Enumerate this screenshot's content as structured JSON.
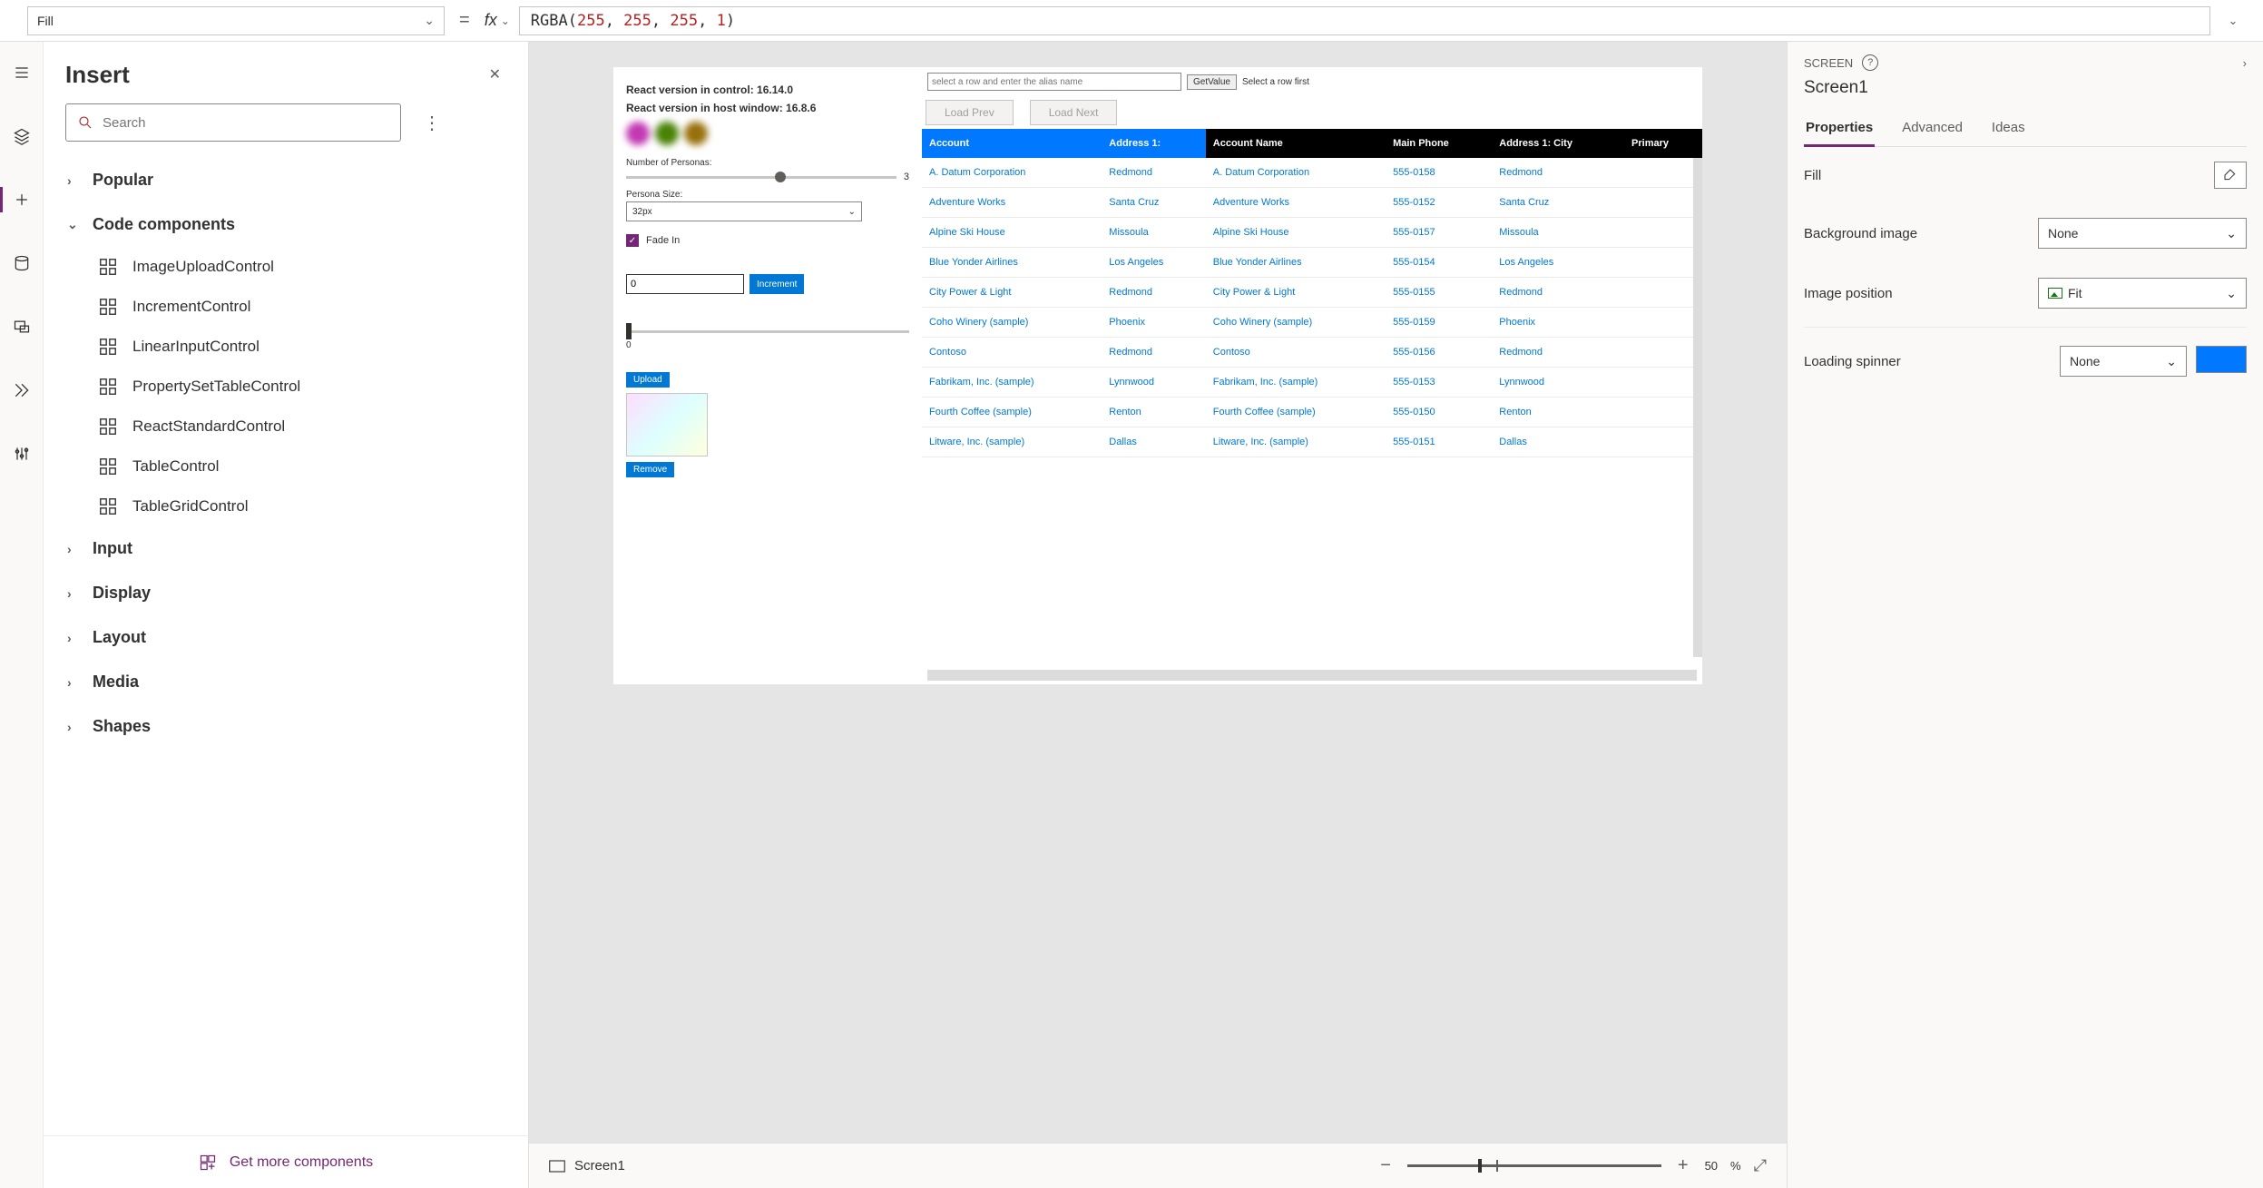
{
  "formula_bar": {
    "property": "Fill",
    "fx_label": "fx",
    "eq": "=",
    "formula_fn": "RGBA",
    "formula_args": [
      "255",
      "255",
      "255",
      "1"
    ]
  },
  "insert_panel": {
    "title": "Insert",
    "search_placeholder": "Search",
    "groups": {
      "popular": "Popular",
      "code_components": "Code components",
      "input": "Input",
      "display": "Display",
      "layout": "Layout",
      "media": "Media",
      "shapes": "Shapes"
    },
    "code_items": [
      "ImageUploadControl",
      "IncrementControl",
      "LinearInputControl",
      "PropertySetTableControl",
      "ReactStandardControl",
      "TableControl",
      "TableGridControl"
    ],
    "footer": "Get more components"
  },
  "canvas": {
    "left_pane": {
      "react_control": "React version in control: 16.14.0",
      "react_host": "React version in host window: 16.8.6",
      "num_personas_label": "Number of Personas:",
      "num_personas_value": "3",
      "persona_size_label": "Persona Size:",
      "persona_size_value": "32px",
      "fade_label": "Fade In",
      "increment_value": "0",
      "increment_btn": "Increment",
      "slider2_value": "0",
      "upload_btn": "Upload",
      "remove_btn": "Remove"
    },
    "right_pane": {
      "alias_placeholder": "select a row and enter the alias name",
      "get_value": "GetValue",
      "hint": "Select a row first",
      "load_prev": "Load Prev",
      "load_next": "Load Next",
      "headers": [
        "Account",
        "Address 1:",
        "Account Name",
        "Main Phone",
        "Address 1: City",
        "Primary"
      ],
      "rows": [
        [
          "A. Datum Corporation",
          "Redmond",
          "A. Datum Corporation",
          "555-0158",
          "Redmond"
        ],
        [
          "Adventure Works",
          "Santa Cruz",
          "Adventure Works",
          "555-0152",
          "Santa Cruz"
        ],
        [
          "Alpine Ski House",
          "Missoula",
          "Alpine Ski House",
          "555-0157",
          "Missoula"
        ],
        [
          "Blue Yonder Airlines",
          "Los Angeles",
          "Blue Yonder Airlines",
          "555-0154",
          "Los Angeles"
        ],
        [
          "City Power & Light",
          "Redmond",
          "City Power & Light",
          "555-0155",
          "Redmond"
        ],
        [
          "Coho Winery (sample)",
          "Phoenix",
          "Coho Winery (sample)",
          "555-0159",
          "Phoenix"
        ],
        [
          "Contoso",
          "Redmond",
          "Contoso",
          "555-0156",
          "Redmond"
        ],
        [
          "Fabrikam, Inc. (sample)",
          "Lynnwood",
          "Fabrikam, Inc. (sample)",
          "555-0153",
          "Lynnwood"
        ],
        [
          "Fourth Coffee (sample)",
          "Renton",
          "Fourth Coffee (sample)",
          "555-0150",
          "Renton"
        ],
        [
          "Litware, Inc. (sample)",
          "Dallas",
          "Litware, Inc. (sample)",
          "555-0151",
          "Dallas"
        ]
      ]
    },
    "footer": {
      "breadcrumb": "Screen1",
      "zoom_pct": "50",
      "zoom_unit": "%"
    }
  },
  "props_panel": {
    "kind": "SCREEN",
    "name": "Screen1",
    "tabs": {
      "properties": "Properties",
      "advanced": "Advanced",
      "ideas": "Ideas"
    },
    "rows": {
      "fill": "Fill",
      "bg_image": "Background image",
      "bg_image_val": "None",
      "img_pos": "Image position",
      "img_pos_val": "Fit",
      "loading": "Loading spinner",
      "loading_val": "None"
    }
  }
}
